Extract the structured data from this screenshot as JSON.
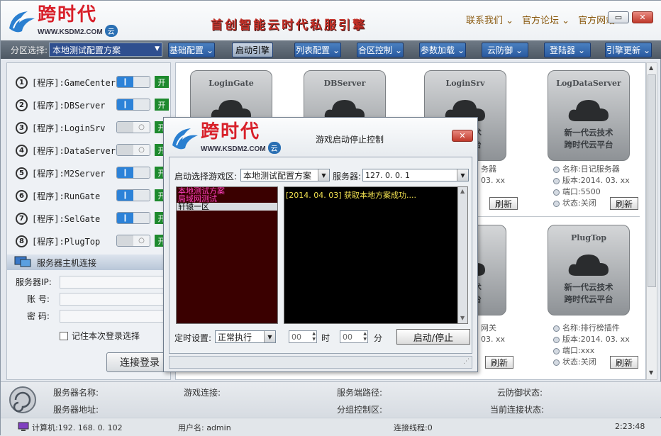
{
  "app": {
    "brand": "跨时代",
    "url": "WWW.KSDM2.COM",
    "cloud": "云",
    "slogan": "首创智能云时代私服引擎",
    "links": [
      "联系我们 ⌄",
      "官方论坛 ⌄",
      "官方网站"
    ],
    "minimize": "▭",
    "close": "✕"
  },
  "toolbar": {
    "zone_label": "分区选择:",
    "zone_value": "本地测试配置方案",
    "buttons": [
      "基础配置",
      "启动引擎",
      "列表配置",
      "合区控制",
      "参数加载",
      "云防御",
      "登陆器",
      "引擎更新"
    ],
    "active": "启动引擎"
  },
  "programs": [
    {
      "num": "1",
      "label": "[程序]:GameCenter",
      "on": true,
      "switch": "开"
    },
    {
      "num": "2",
      "label": "[程序]:DBServer",
      "on": true,
      "switch": "开"
    },
    {
      "num": "3",
      "label": "[程序]:LoginSrv",
      "on": false,
      "switch": "开"
    },
    {
      "num": "4",
      "label": "[程序]:DataServer",
      "on": false,
      "switch": "开"
    },
    {
      "num": "5",
      "label": "[程序]:M2Server",
      "on": true,
      "switch": "开"
    },
    {
      "num": "6",
      "label": "[程序]:RunGate",
      "on": true,
      "switch": "开"
    },
    {
      "num": "7",
      "label": "[程序]:SelGate",
      "on": true,
      "switch": "开"
    },
    {
      "num": "8",
      "label": "[程序]:PlugTop",
      "on": false,
      "switch": "开"
    }
  ],
  "connection": {
    "header": "服务器主机连接",
    "ip_label": "服务器IP:",
    "account_label": "账  号:",
    "password_label": "密  码:",
    "remember_label": "记住本次登录选择",
    "login_button": "连接登录"
  },
  "cards": [
    {
      "title": "LoginGate",
      "cap1": "",
      "cap2": ""
    },
    {
      "title": "DBServer",
      "cap1": "",
      "cap2": ""
    },
    {
      "title": "LoginSrv",
      "cap1": "代云技术",
      "cap2": "代云平台"
    },
    {
      "title": "LogDataServer",
      "cap1": "新一代云技术",
      "cap2": "跨时代云平台"
    },
    {
      "title": "e",
      "cap1": "代云技术",
      "cap2": "代云平台"
    },
    {
      "title": "PlugTop",
      "cap1": "新一代云技术",
      "cap2": "跨时代云平台"
    }
  ],
  "info_blocks": [
    {
      "lines": [
        "务器",
        "03. xx",
        "",
        ""
      ],
      "refresh": "刷新"
    },
    {
      "lines": [
        "名称:日记服务器",
        "版本:2014. 03. xx",
        "端口:5500",
        "状态:关闭"
      ],
      "refresh": "刷新"
    },
    {
      "lines": [
        "网关",
        "03. xx",
        "",
        ""
      ],
      "refresh": "刷新"
    },
    {
      "lines": [
        "名称:排行榜插件",
        "版本:2014. 03. xx",
        "端口:xxx",
        "状态:关闭"
      ],
      "refresh": "刷新"
    }
  ],
  "status": {
    "server_name": "服务器名称:",
    "server_addr": "服务器地址:",
    "game_conn": "游戏连接:",
    "server_path": "服务端路径:",
    "group_ctrl": "分组控制区:",
    "cloud_status": "云防御状态:",
    "current_conn": "当前连接状态:"
  },
  "bottom": {
    "computer": "计算机:192. 168. 0. 102",
    "username": "用户名: admin",
    "threads": "连接线程:0",
    "time": "2:23:48"
  },
  "dialog": {
    "title": "游戏启动停止控制",
    "zone_label": "启动选择游戏区:",
    "zone_value": "本地测试配置方案",
    "server_label": "服务器:",
    "server_value": "127. 0. 0. 1",
    "zones": [
      {
        "text": "本地测试方案",
        "color": "#ff40c0",
        "bg": "transparent"
      },
      {
        "text": "局域网测试",
        "color": "#ff40c0",
        "bg": "transparent"
      },
      {
        "text": "轩辕一区",
        "color": "#000000",
        "bg": "#d8dce0"
      }
    ],
    "log": "[2014. 04. 03] 获取本地方案成功....",
    "timer_label": "定时设置:",
    "timer_value": "正常执行",
    "hour_value": "00",
    "hour_label": "时",
    "min_value": "00",
    "min_label": "分",
    "start_button": "启动/停止"
  }
}
